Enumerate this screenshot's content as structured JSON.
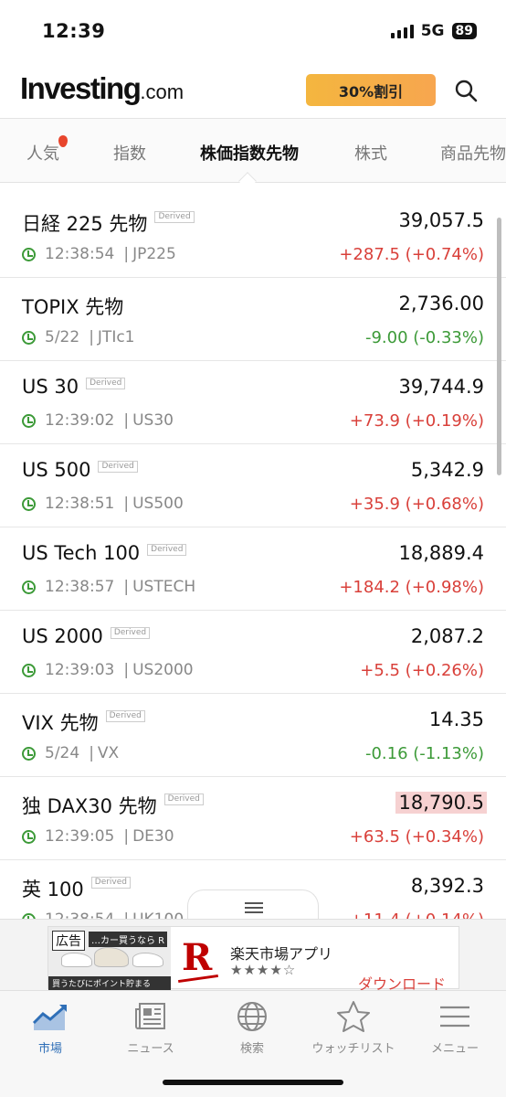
{
  "status_bar": {
    "time": "12:39",
    "network": "5G",
    "battery": "89"
  },
  "header": {
    "logo_brand": "Investing",
    "logo_domain": ".com",
    "promo_label": "30%割引"
  },
  "tabs": [
    {
      "label": "人気"
    },
    {
      "label": "指数"
    },
    {
      "label": "株価指数先物"
    },
    {
      "label": "株式"
    },
    {
      "label": "商品先物"
    }
  ],
  "derived_tag": "Derived",
  "instruments": [
    {
      "name": "日経 225 先物",
      "derived": true,
      "price": "39,057.5",
      "time": "12:38:54",
      "symbol": "JP225",
      "change": "+287.5 (+0.74%)",
      "direction": "up"
    },
    {
      "name": "TOPIX 先物",
      "derived": false,
      "price": "2,736.00",
      "time": "5/22",
      "symbol": "JTIc1",
      "change": "-9.00 (-0.33%)",
      "direction": "down"
    },
    {
      "name": "US 30",
      "derived": true,
      "price": "39,744.9",
      "time": "12:39:02",
      "symbol": "US30",
      "change": "+73.9 (+0.19%)",
      "direction": "up"
    },
    {
      "name": "US 500",
      "derived": true,
      "price": "5,342.9",
      "time": "12:38:51",
      "symbol": "US500",
      "change": "+35.9 (+0.68%)",
      "direction": "up"
    },
    {
      "name": "US Tech 100",
      "derived": true,
      "price": "18,889.4",
      "time": "12:38:57",
      "symbol": "USTECH",
      "change": "+184.2 (+0.98%)",
      "direction": "up"
    },
    {
      "name": "US 2000",
      "derived": true,
      "price": "2,087.2",
      "time": "12:39:03",
      "symbol": "US2000",
      "change": "+5.5 (+0.26%)",
      "direction": "up"
    },
    {
      "name": "VIX 先物",
      "derived": true,
      "price": "14.35",
      "time": "5/24",
      "symbol": "VX",
      "change": "-0.16 (-1.13%)",
      "direction": "down"
    },
    {
      "name": "独 DAX30 先物",
      "derived": true,
      "price": "18,790.5",
      "time": "12:39:05",
      "symbol": "DE30",
      "change": "+63.5 (+0.34%)",
      "direction": "up",
      "highlight": true
    },
    {
      "name": "英 100",
      "derived": true,
      "price": "8,392.3",
      "time": "12:38:54",
      "symbol": "UK100",
      "change": "+11.4 (+0.14%)",
      "direction": "up"
    }
  ],
  "ad": {
    "badge": "広告",
    "image_top_text": "…カー買うなら R",
    "image_bottom_text": "買うたびにポイント貯まる",
    "title": "楽天市場アプリ",
    "rating": "★★★★☆",
    "cta": "ダウンロード",
    "logo": "R"
  },
  "bottom_nav": [
    {
      "label": "市場",
      "icon": "chart-icon",
      "active": true
    },
    {
      "label": "ニュース",
      "icon": "newspaper-icon"
    },
    {
      "label": "検索",
      "icon": "globe-icon"
    },
    {
      "label": "ウォッチリスト",
      "icon": "star-icon"
    },
    {
      "label": "メニュー",
      "icon": "menu-icon"
    }
  ],
  "colors": {
    "up": "#d9403a",
    "down": "#3c9a38",
    "promo": "#f4b63f",
    "active_nav": "#2f6fb7",
    "highlight": "#f6d1d1"
  }
}
